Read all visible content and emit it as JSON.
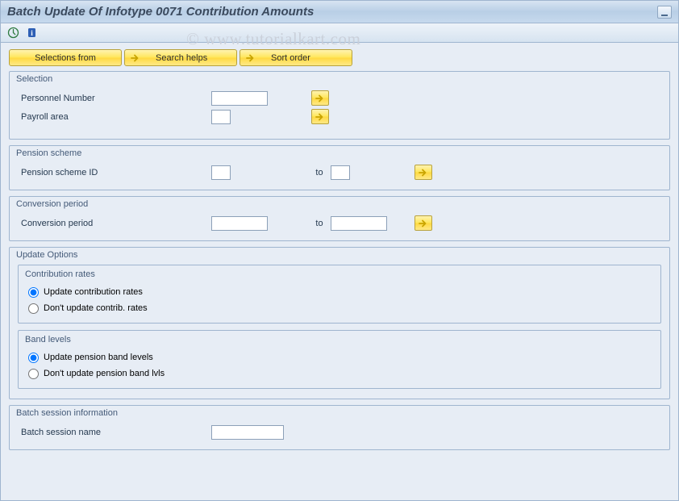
{
  "title": "Batch Update Of Infotype 0071 Contribution Amounts",
  "watermark": "© www.tutorialkart.com",
  "toolbar_icons": {
    "execute": "execute",
    "info": "info"
  },
  "buttons": {
    "selections_from": "Selections from",
    "search_helps": "Search helps",
    "sort_order": "Sort order"
  },
  "groups": {
    "selection": {
      "title": "Selection",
      "personnel_number_label": "Personnel Number",
      "personnel_number_value": "",
      "payroll_area_label": "Payroll area",
      "payroll_area_value": ""
    },
    "pension": {
      "title": "Pension scheme",
      "id_label": "Pension scheme ID",
      "id_from": "",
      "to_label": "to",
      "id_to": ""
    },
    "conversion": {
      "title": "Conversion period",
      "label": "Conversion period",
      "from": "",
      "to_label": "to",
      "to": ""
    },
    "update": {
      "title": "Update Options",
      "contribution": {
        "title": "Contribution rates",
        "opt1": "Update contribution rates",
        "opt2": "Don't update contrib. rates"
      },
      "band": {
        "title": "Band levels",
        "opt1": "Update pension band levels",
        "opt2": "Don't update pension band lvls"
      }
    },
    "batch": {
      "title": "Batch session information",
      "name_label": "Batch session name",
      "name_value": ""
    }
  }
}
